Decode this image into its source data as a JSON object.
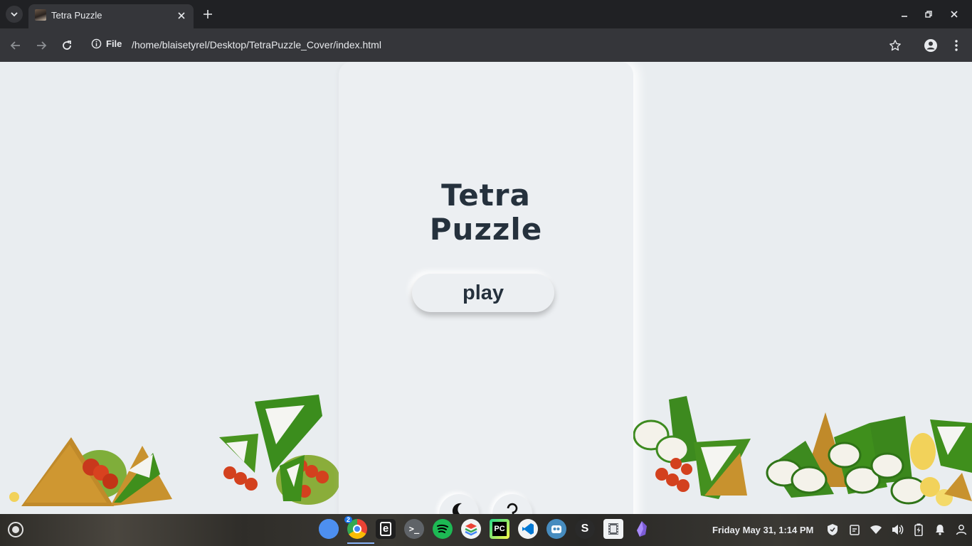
{
  "browser": {
    "tab_title": "Tetra Puzzle",
    "site_label": "File",
    "url": "/home/blaisetyrel/Desktop/TetraPuzzle_Cover/index.html"
  },
  "page": {
    "title_line1": "Tetra",
    "title_line2": "Puzzle",
    "play_label": "play",
    "colors": {
      "background": "#e9edf0",
      "card": "#eceff2",
      "text": "#25313d"
    }
  },
  "shelf": {
    "apps": [
      {
        "name": "files",
        "icon": "files-icon"
      },
      {
        "name": "chrome",
        "icon": "chrome-icon",
        "badge": "2",
        "active": true
      },
      {
        "name": "text-editor",
        "icon": "text-editor-icon"
      },
      {
        "name": "terminal",
        "icon": "terminal-icon"
      },
      {
        "name": "spotify",
        "icon": "spotify-icon"
      },
      {
        "name": "layers-app",
        "icon": "layers-icon"
      },
      {
        "name": "pycharm",
        "icon": "pycharm-icon"
      },
      {
        "name": "vscode",
        "icon": "vscode-icon"
      },
      {
        "name": "godot",
        "icon": "godot-icon"
      },
      {
        "name": "s-app",
        "icon": "s-app-icon"
      },
      {
        "name": "video-player",
        "icon": "film-icon"
      },
      {
        "name": "obsidian",
        "icon": "obsidian-icon"
      }
    ],
    "clock": "Friday May 31, 1:14 PM"
  }
}
